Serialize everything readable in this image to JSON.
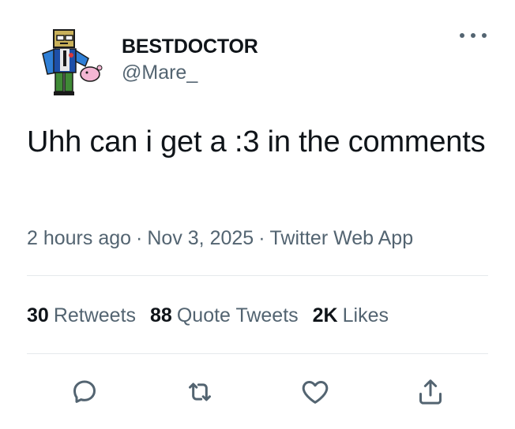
{
  "author": {
    "display_name": "BESTDOCTOR",
    "handle": "@Mare_"
  },
  "tweet": {
    "text": "Uhh can i get a :3 in the comments"
  },
  "meta": {
    "time": "2 hours ago",
    "date": "Nov 3, 2025",
    "source": "Twitter Web App",
    "separator": "·"
  },
  "stats": {
    "retweets": {
      "count": "30",
      "label": "Retweets"
    },
    "quote_tweets": {
      "count": "88",
      "label": "Quote Tweets"
    },
    "likes": {
      "count": "2K",
      "label": "Likes"
    }
  },
  "icons": {
    "more": "more-horizontal-icon",
    "reply": "reply-icon",
    "retweet": "retweet-icon",
    "like": "heart-icon",
    "share": "share-icon"
  },
  "colors": {
    "text_primary": "#0f1419",
    "text_secondary": "#536471",
    "divider": "#e5e9ec",
    "icon": "#536471"
  }
}
